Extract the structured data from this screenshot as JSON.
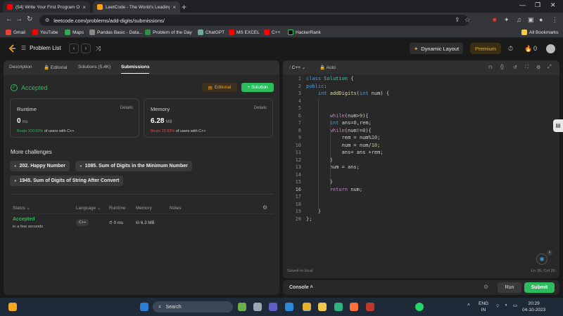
{
  "browser": {
    "tabs": [
      {
        "title": "(54) Write Your First Program Or",
        "color": "#ff0000"
      },
      {
        "title": "LeetCode - The World's Leading",
        "color": "#ffa116"
      }
    ],
    "url": "leetcode.com/problems/add-digits/submissions/",
    "bookmarks": [
      "Gmail",
      "YouTube",
      "Maps",
      "Pandas Basic - Data...",
      "Problem of the Day",
      "ChatGPT",
      "MS EXCEL",
      "C++",
      "HackerRank"
    ],
    "all_bookmarks": "All Bookmarks"
  },
  "nav": {
    "problem_list": "Problem List",
    "dynamic_layout": "Dynamic Layout",
    "premium": "Premium",
    "coins": "0"
  },
  "left": {
    "tabs": [
      "Description",
      "Editorial",
      "Solutions (5.4K)",
      "Submissions"
    ],
    "status": "Accepted",
    "editorial_btn": "Editorial",
    "solution_btn": "+ Solution",
    "runtime": {
      "title": "Runtime",
      "details": "Details",
      "value": "0",
      "unit": "ms",
      "beats_pct": "Beats 100.00%",
      "beats_rest": "of users with C++"
    },
    "memory": {
      "title": "Memory",
      "details": "Details",
      "value": "6.28",
      "unit": "MB",
      "beats_pct": "Beats 23.93%",
      "beats_rest": "of users with C++"
    },
    "more_challenges": "More challenges",
    "challenges": [
      "202. Happy Number",
      "1085. Sum of Digits in the Minimum Number",
      "1945. Sum of Digits of String After Convert"
    ],
    "table_headers": [
      "Status",
      "Language",
      "Runtime",
      "Memory",
      "Notes"
    ],
    "row": {
      "status": "Accepted",
      "when": "in a few seconds",
      "language": "C++",
      "runtime": "0 ms",
      "memory": "6.3 MB"
    }
  },
  "editor": {
    "language": "C++",
    "mode": "Auto",
    "lines": [
      "class Solution {",
      "public:",
      "    int addDigits(int num) {",
      "",
      "",
      "        while(num>9){",
      "        int ans=0,rem;",
      "        while(num!=0){",
      "            rem = num%10;",
      "            num = num/10;",
      "            ans= ans +rem;",
      "        }",
      "        num = ans;",
      "",
      "        }",
      "        return num;",
      "",
      "",
      "    }",
      "};"
    ],
    "saved": "Saved to local",
    "cursor": "Ln 16, Col 20"
  },
  "console": {
    "label": "Console",
    "run": "Run",
    "submit": "Submit"
  },
  "taskbar": {
    "search": "Search",
    "lang": "ENG",
    "region": "IN",
    "time": "20:29",
    "date": "04-10-2023"
  }
}
